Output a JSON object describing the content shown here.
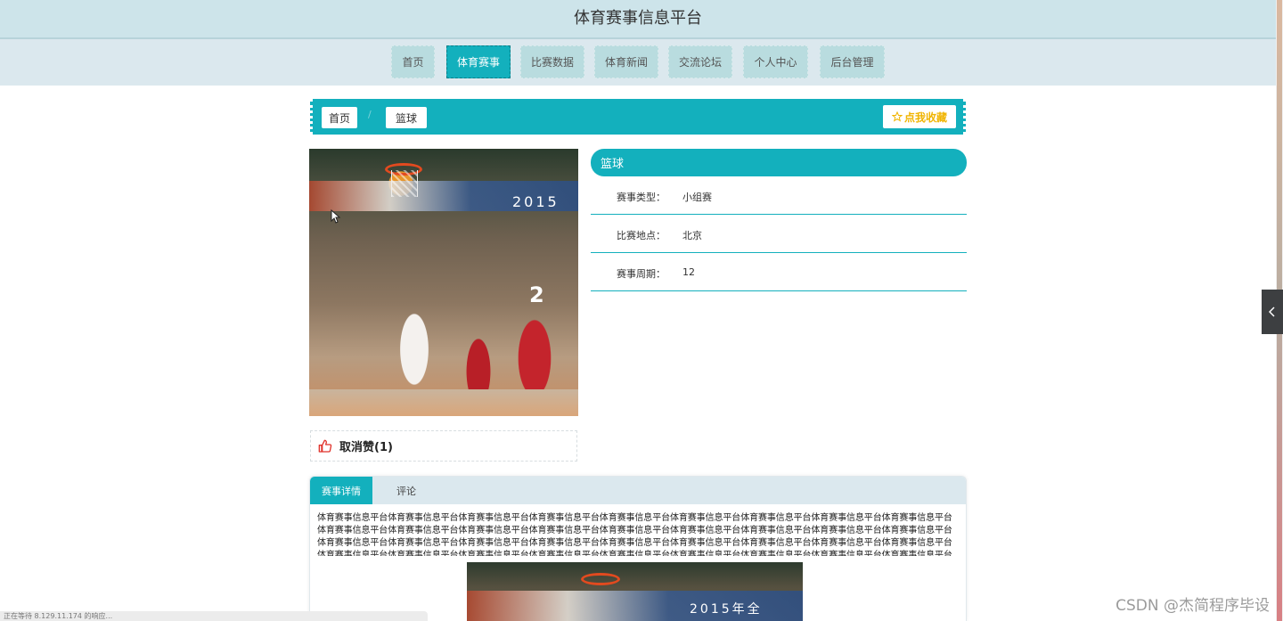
{
  "header": {
    "title": "体育赛事信息平台"
  },
  "nav": {
    "items": [
      {
        "label": "首页",
        "active": false
      },
      {
        "label": "体育赛事",
        "active": true
      },
      {
        "label": "比赛数据",
        "active": false
      },
      {
        "label": "体育新闻",
        "active": false
      },
      {
        "label": "交流论坛",
        "active": false
      },
      {
        "label": "个人中心",
        "active": false
      },
      {
        "label": "后台管理",
        "active": false
      }
    ]
  },
  "breadcrumb": {
    "home": "首页",
    "separator": "/",
    "current": "篮球",
    "favorite_label": "点我收藏",
    "favorite_icon": "star-outline-icon"
  },
  "photo": {
    "banner_text": "2015",
    "jersey_number": "2"
  },
  "like": {
    "label": "取消赞(1)",
    "icon": "thumbs-up-icon"
  },
  "info": {
    "title": "篮球",
    "rows": [
      {
        "key": "赛事类型：",
        "value": "小组赛"
      },
      {
        "key": "比赛地点：",
        "value": "北京"
      },
      {
        "key": "赛事周期：",
        "value": "12"
      }
    ]
  },
  "tabs": {
    "items": [
      {
        "label": "赛事详情",
        "active": true
      },
      {
        "label": "评论",
        "active": false
      }
    ],
    "detail_text": "体育赛事信息平台体育赛事信息平台体育赛事信息平台体育赛事信息平台体育赛事信息平台体育赛事信息平台体育赛事信息平台体育赛事信息平台体育赛事信息平台体育赛事信息平台体育赛事信息平台体育赛事信息平台体育赛事信息平台体育赛事信息平台体育赛事信息平台体育赛事信息平台体育赛事信息平台体育赛事信息平台体育赛事信息平台体育赛事信息平台体育赛事信息平台体育赛事信息平台体育赛事信息平台体育赛事信息平台体育赛事信息平台体育赛事信息平台体育赛事信息平台体育赛事信息平台体育赛事信息平台体育赛事信息平台体育赛事信息平台体育赛事信息平台体育赛事信息平台体育赛事信息平台体育赛事信息平台体育赛事信息平台体育赛事信息平台体育赛事信息平台体育赛事信息平台体育赛事信息平台",
    "image_text": "2015年全"
  },
  "status_bar": {
    "text": "正在等待 8.129.11.174 的响应..."
  },
  "watermark": {
    "text": "CSDN @杰简程序毕设"
  },
  "side_toggle": {
    "icon": "chevron-left-icon"
  },
  "colors": {
    "accent": "#13b0bd",
    "header_bg": "#cde4ea",
    "nav_bg": "#dbe8ee",
    "nav_item_bg": "#b9dcdf",
    "favorite_text": "#f0b400"
  }
}
